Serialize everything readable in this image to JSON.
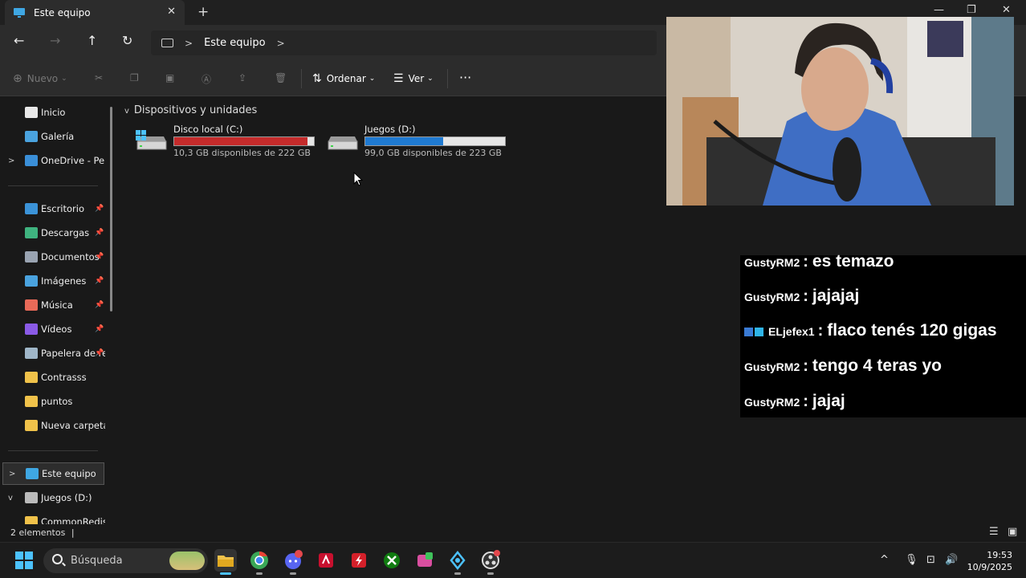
{
  "window": {
    "tab_title": "Este equipo",
    "close_tab": "✕",
    "new_tab": "+",
    "minimize": "—",
    "maximize": "❐",
    "close": "✕"
  },
  "nav": {
    "back": "←",
    "forward": "→",
    "up": "↑",
    "refresh": "↻",
    "breadcrumb_sep": ">",
    "breadcrumb": "Este equipo",
    "breadcrumb_more": ">"
  },
  "commands": {
    "new_label": "Nuevo",
    "sort_label": "Ordenar",
    "view_label": "Ver",
    "more": "···"
  },
  "sidebar": {
    "items": [
      {
        "label": "Inicio",
        "icon": "home-icon",
        "color": "#e8e8e8",
        "pinned": false,
        "expander": ""
      },
      {
        "label": "Galería",
        "icon": "gallery-icon",
        "color": "#4aa3df",
        "pinned": false,
        "expander": ""
      },
      {
        "label": "OneDrive - Personal",
        "icon": "cloud-icon",
        "color": "#3a8fd8",
        "pinned": false,
        "expander": ">"
      },
      {
        "label": "Escritorio",
        "icon": "desktop-icon",
        "color": "#3b93d8",
        "pinned": true,
        "expander": ""
      },
      {
        "label": "Descargas",
        "icon": "download-icon",
        "color": "#3fb37f",
        "pinned": true,
        "expander": ""
      },
      {
        "label": "Documentos",
        "icon": "document-icon",
        "color": "#9aa4b2",
        "pinned": true,
        "expander": ""
      },
      {
        "label": "Imágenes",
        "icon": "pictures-icon",
        "color": "#4aa3df",
        "pinned": true,
        "expander": ""
      },
      {
        "label": "Música",
        "icon": "music-icon",
        "color": "#e96a58",
        "pinned": true,
        "expander": ""
      },
      {
        "label": "Vídeos",
        "icon": "videos-icon",
        "color": "#8a5ae6",
        "pinned": true,
        "expander": ""
      },
      {
        "label": "Papelera de reciclaje",
        "icon": "recycle-bin-icon",
        "color": "#9fb6c8",
        "pinned": true,
        "expander": ""
      },
      {
        "label": "Contrasss",
        "icon": "folder-icon",
        "color": "#f0c24a",
        "pinned": false,
        "expander": ""
      },
      {
        "label": "puntos",
        "icon": "folder-icon",
        "color": "#f0c24a",
        "pinned": false,
        "expander": ""
      },
      {
        "label": "Nueva carpeta",
        "icon": "folder-icon",
        "color": "#f0c24a",
        "pinned": false,
        "expander": ""
      },
      {
        "label": "Este equipo",
        "icon": "computer-icon",
        "color": "#3fa7e3",
        "pinned": false,
        "expander": ">"
      },
      {
        "label": "Juegos (D:)",
        "icon": "drive-icon",
        "color": "#bbbbbb",
        "pinned": false,
        "expander": "v"
      },
      {
        "label": "CommonRedist",
        "icon": "folder-icon",
        "color": "#f0c24a",
        "pinned": false,
        "expander": ""
      }
    ],
    "pin_glyph": "📌"
  },
  "main": {
    "group_header": "Dispositivos y unidades",
    "group_chevron": "v",
    "drives": [
      {
        "name": "Disco local (C:)",
        "free_text": "10,3 GB disponibles de 222 GB",
        "used_fraction": 0.954,
        "bar_color": "#c42b2b",
        "icon": "windows-drive-icon"
      },
      {
        "name": "Juegos (D:)",
        "free_text": "99,0 GB disponibles de 223 GB",
        "used_fraction": 0.556,
        "bar_color": "#1f7ad1",
        "icon": "drive-icon"
      }
    ]
  },
  "status": {
    "item_count": "2 elementos"
  },
  "chat": {
    "messages": [
      {
        "user": "GustyRM2",
        "text": "es temazo",
        "badges": false
      },
      {
        "user": "GustyRM2",
        "text": "jajajaj",
        "badges": false
      },
      {
        "user": "ELjefex1",
        "text": "flaco tenés 120 gigas",
        "badges": true
      },
      {
        "user": "GustyRM2",
        "text": "tengo 4 teras yo",
        "badges": false
      },
      {
        "user": "GustyRM2",
        "text": "jajaj",
        "badges": false
      }
    ]
  },
  "taskbar": {
    "search_placeholder": "Búsqueda",
    "tray_chevron": "^",
    "time": "19:53",
    "date": "10/9/2025"
  }
}
